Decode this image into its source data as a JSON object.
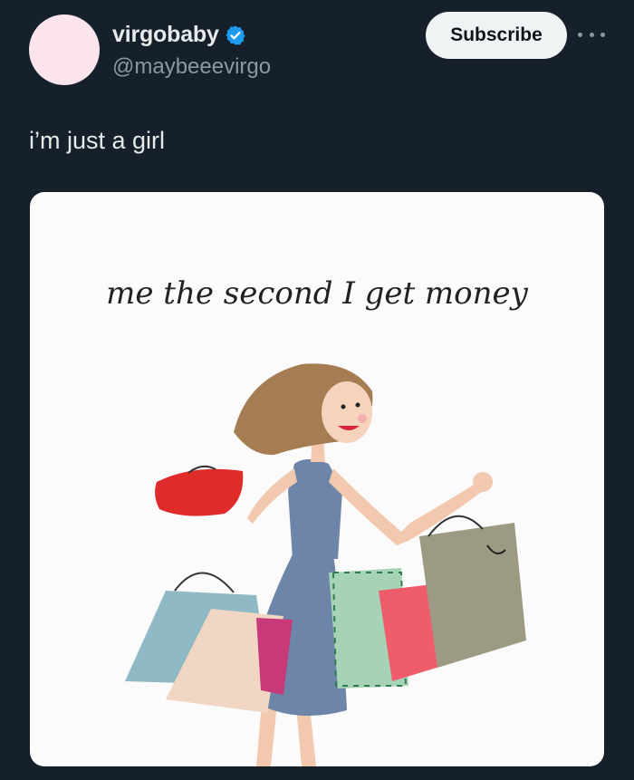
{
  "user": {
    "display_name": "virgobaby",
    "handle": "@maybeeevirgo",
    "verified": true,
    "verified_icon": "verified-badge-icon",
    "avatar_color": "#fce4ec"
  },
  "actions": {
    "subscribe_label": "Subscribe",
    "more_icon": "more-options-icon"
  },
  "tweet": {
    "text": "i’m just a girl"
  },
  "media": {
    "caption": "me the second I get money",
    "illustration": "woman-with-shopping-bags-illustration"
  },
  "colors": {
    "background": "#15202b",
    "text": "#e7e9ea",
    "secondary_text": "#8b98a5",
    "verified_blue": "#1d9bf0",
    "button_bg": "#eff3f4"
  }
}
